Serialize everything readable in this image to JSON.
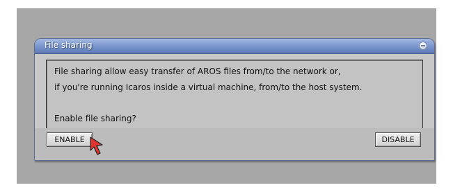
{
  "dialog": {
    "title": "File sharing",
    "message_line1": "File sharing allow easy transfer of AROS files from/to the network or,",
    "message_line2": "if you're running Icaros inside a virtual machine, from/to the host system.",
    "question": "Enable file sharing?"
  },
  "buttons": {
    "enable_label": "ENABLE",
    "disable_label": "DISABLE"
  },
  "icons": {
    "titlebar_button": "close-icon",
    "pointer": "mouse-cursor-icon"
  },
  "colors": {
    "titlebar": "#7f9ad0",
    "desktop": "#a7a7a7",
    "cursor": "#e0342e"
  }
}
